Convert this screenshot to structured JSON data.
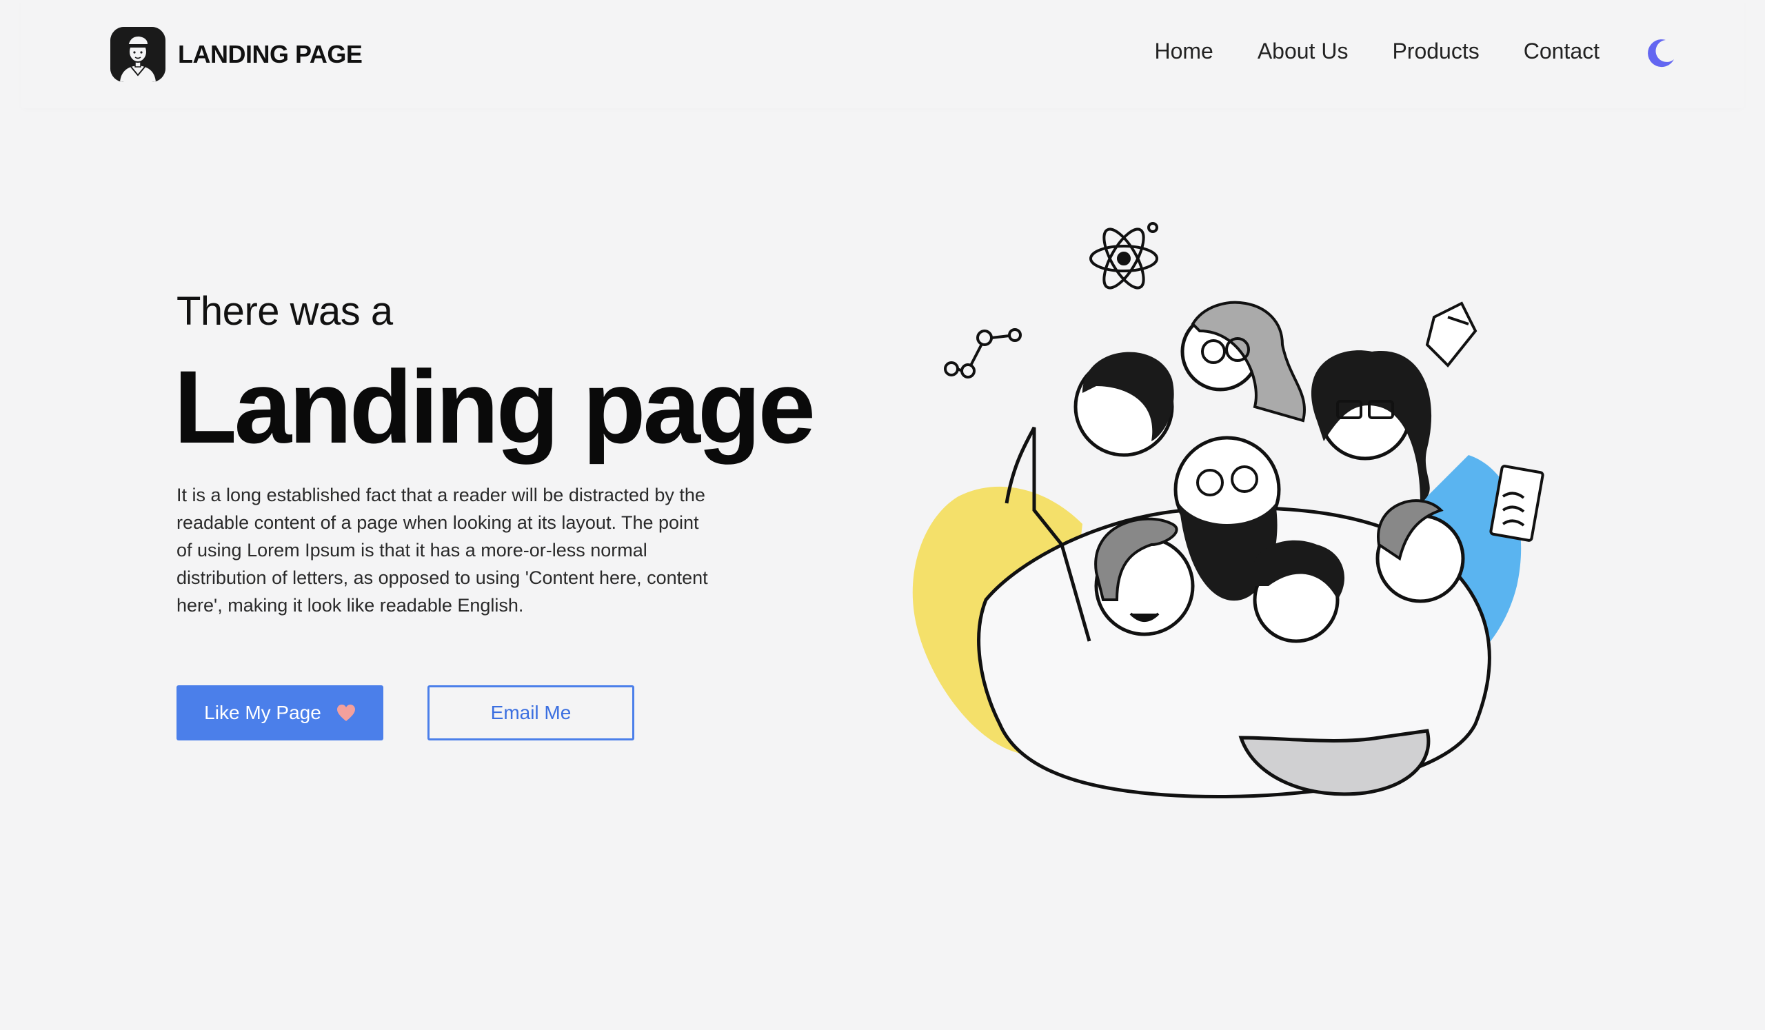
{
  "navbar": {
    "brand_name": "LANDING PAGE",
    "links": [
      "Home",
      "About Us",
      "Products",
      "Contact"
    ],
    "theme_toggle_icon": "moon-icon",
    "accent_color": "#6366f1"
  },
  "hero": {
    "pre_title": "There was a",
    "title": "Landing page",
    "description": "It is a long established fact that a reader will be distracted by the readable content of a page when looking at its layout. The point of using Lorem Ipsum is that it has a more-or-less normal distribution of letters, as opposed to using 'Content here, content here', making it look like readable English.",
    "primary_button": "Like My Page",
    "primary_button_icon": "heart-icon",
    "secondary_button": "Email Me",
    "button_color": "#4b7fea"
  },
  "illustration": {
    "icon": "group-of-people-illustration",
    "accent_yellow": "#f4e06a",
    "accent_blue": "#5ab4f0"
  }
}
